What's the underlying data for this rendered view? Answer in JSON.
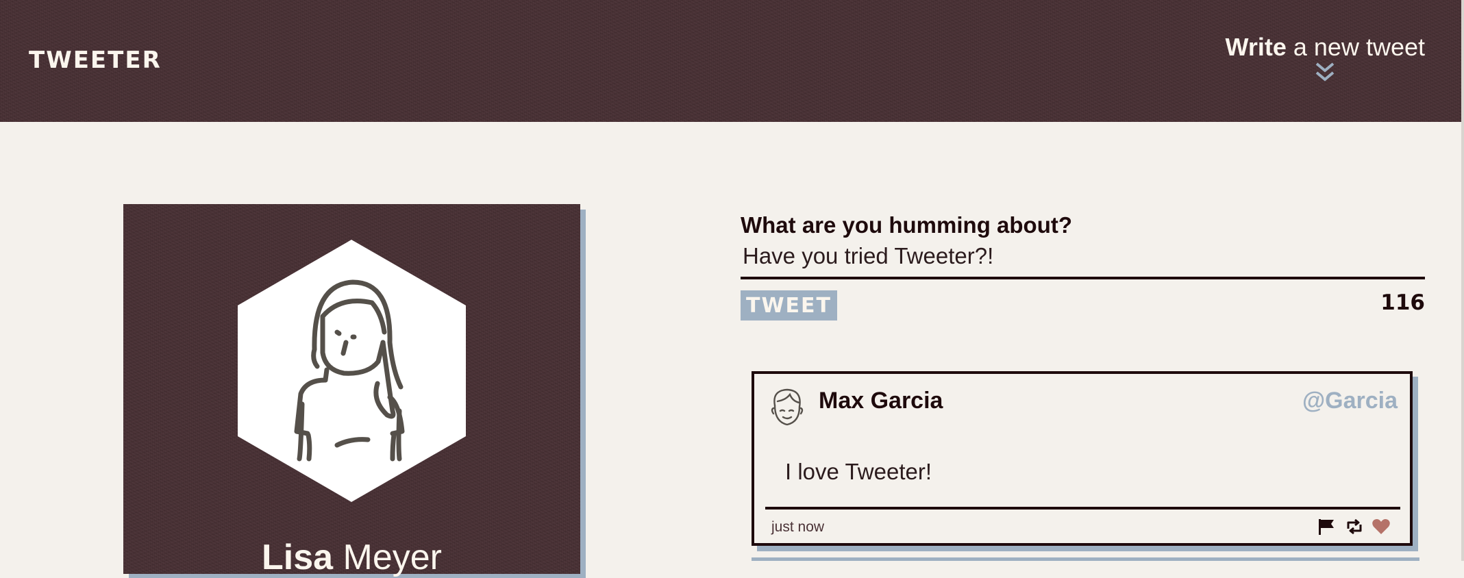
{
  "nav": {
    "brand": "TWEETER",
    "compose_toggle": {
      "strong": "Write",
      "rest": " a new tweet",
      "icon": "double-chevron-down"
    }
  },
  "profile": {
    "first_name": "Lisa",
    "last_name": "Meyer",
    "avatar_icon": "woman-avatar"
  },
  "compose": {
    "label": "What are you humming about?",
    "input_value": "Have you tried Tweeter?!",
    "button_label": "TWEET",
    "char_count": "116"
  },
  "tweets": [
    {
      "name": "Max Garcia",
      "handle": "@Garcia",
      "text": "I love Tweeter!",
      "time": "just now",
      "avatar_icon": "man-avatar",
      "actions": [
        "flag-icon",
        "retweet-icon",
        "heart-icon"
      ]
    }
  ],
  "colors": {
    "texture_base": "#4a3236",
    "background": "#f4f1ec",
    "ink": "#1e0a0c",
    "accent": "#9eb0c2",
    "heart": "#b57268"
  }
}
